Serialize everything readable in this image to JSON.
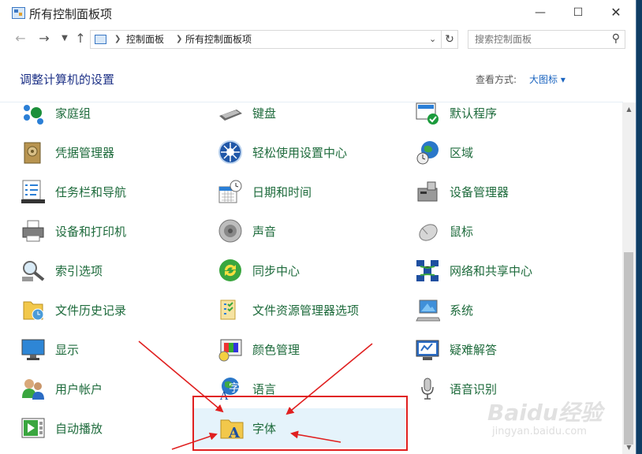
{
  "window": {
    "title": "所有控制面板项"
  },
  "nav": {
    "breadcrumb": [
      "控制面板",
      "所有控制面板项"
    ],
    "search_placeholder": "搜索控制面板"
  },
  "header": {
    "title": "调整计算机的设置",
    "view_by_label": "查看方式:",
    "view_by_value": "大图标 ▾"
  },
  "items": [
    {
      "label": "家庭组",
      "icon": "homegroup-icon"
    },
    {
      "label": "键盘",
      "icon": "keyboard-icon"
    },
    {
      "label": "默认程序",
      "icon": "default-programs-icon"
    },
    {
      "label": "凭据管理器",
      "icon": "credential-manager-icon"
    },
    {
      "label": "轻松使用设置中心",
      "icon": "ease-of-access-icon"
    },
    {
      "label": "区域",
      "icon": "region-icon"
    },
    {
      "label": "任务栏和导航",
      "icon": "taskbar-icon"
    },
    {
      "label": "日期和时间",
      "icon": "date-time-icon"
    },
    {
      "label": "设备管理器",
      "icon": "device-manager-icon"
    },
    {
      "label": "设备和打印机",
      "icon": "printer-icon"
    },
    {
      "label": "声音",
      "icon": "speaker-icon"
    },
    {
      "label": "鼠标",
      "icon": "mouse-icon"
    },
    {
      "label": "索引选项",
      "icon": "indexing-icon"
    },
    {
      "label": "同步中心",
      "icon": "sync-icon"
    },
    {
      "label": "网络和共享中心",
      "icon": "network-icon"
    },
    {
      "label": "文件历史记录",
      "icon": "file-history-icon"
    },
    {
      "label": "文件资源管理器选项",
      "icon": "folder-options-icon"
    },
    {
      "label": "系统",
      "icon": "system-icon"
    },
    {
      "label": "显示",
      "icon": "display-icon"
    },
    {
      "label": "颜色管理",
      "icon": "color-management-icon"
    },
    {
      "label": "疑难解答",
      "icon": "troubleshooting-icon"
    },
    {
      "label": "用户帐户",
      "icon": "user-accounts-icon"
    },
    {
      "label": "语言",
      "icon": "language-icon"
    },
    {
      "label": "语音识别",
      "icon": "microphone-icon"
    },
    {
      "label": "自动播放",
      "icon": "autoplay-icon"
    },
    {
      "label": "字体",
      "icon": "fonts-icon",
      "selected": true
    }
  ],
  "colors": {
    "link": "#1e6b3c",
    "title": "#1e3287",
    "accent": "#1a64c0",
    "arrow": "#e02020",
    "highlight_box": "#e02020"
  },
  "watermark": {
    "main": "Baidu经验",
    "sub": "jingyan.baidu.com"
  }
}
